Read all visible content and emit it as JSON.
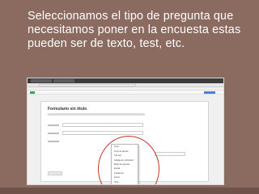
{
  "slide": {
    "heading": "Seleccionamos el tipo de pregunta que necesitamos poner en la encuesta estas pueden ser de texto, test, etc."
  },
  "screenshot": {
    "form_title": "Formulario sin título",
    "question_type_options": [
      "Texto",
      "Texto de párrafo",
      "Tipo test",
      "Casillas de verificación",
      "Elegir de una lista",
      "Escala",
      "Cuadrícula",
      "Fecha",
      "Hora"
    ]
  },
  "colors": {
    "background": "#8b6a60",
    "heading_text": "#ffffff",
    "highlight": "#c0392b"
  }
}
